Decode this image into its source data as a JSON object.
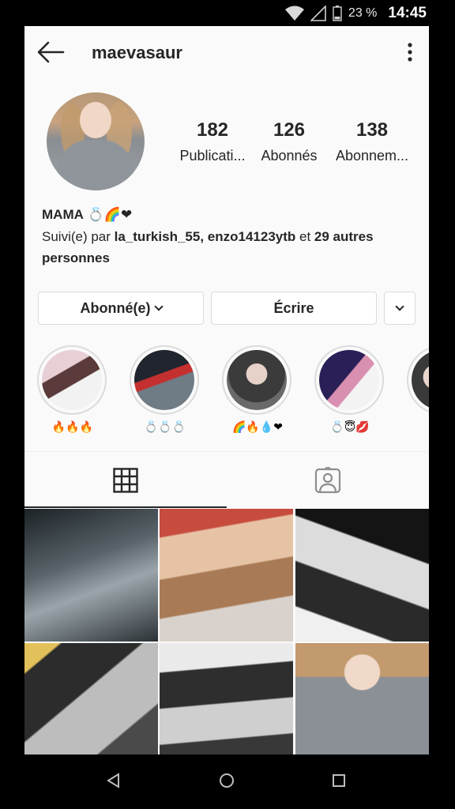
{
  "status_bar": {
    "battery_pct": "23 %",
    "time": "14:45"
  },
  "header": {
    "username": "maevasaur"
  },
  "stats": [
    {
      "value": "182",
      "label": "Publicati..."
    },
    {
      "value": "126",
      "label": "Abonnés"
    },
    {
      "value": "138",
      "label": "Abonnem..."
    }
  ],
  "bio": {
    "name": "MAMA",
    "name_emoji": "💍🌈❤",
    "followed_prefix": "Suivi(e) par ",
    "follower_1": "la_turkish_55",
    "sep": ", ",
    "follower_2": "enzo14123ytb",
    "and": " et ",
    "others": "29 autres personnes"
  },
  "buttons": {
    "following": "Abonné(e)",
    "message": "Écrire"
  },
  "stories": [
    {
      "caption": "🔥🔥🔥"
    },
    {
      "caption": "💍💍💍"
    },
    {
      "caption": "🌈🔥💧❤"
    },
    {
      "caption": "💍😇💋"
    },
    {
      "caption": ""
    }
  ],
  "colors": {
    "accent": "#262626",
    "border": "#dbdbdb",
    "background": "#fafafa"
  }
}
